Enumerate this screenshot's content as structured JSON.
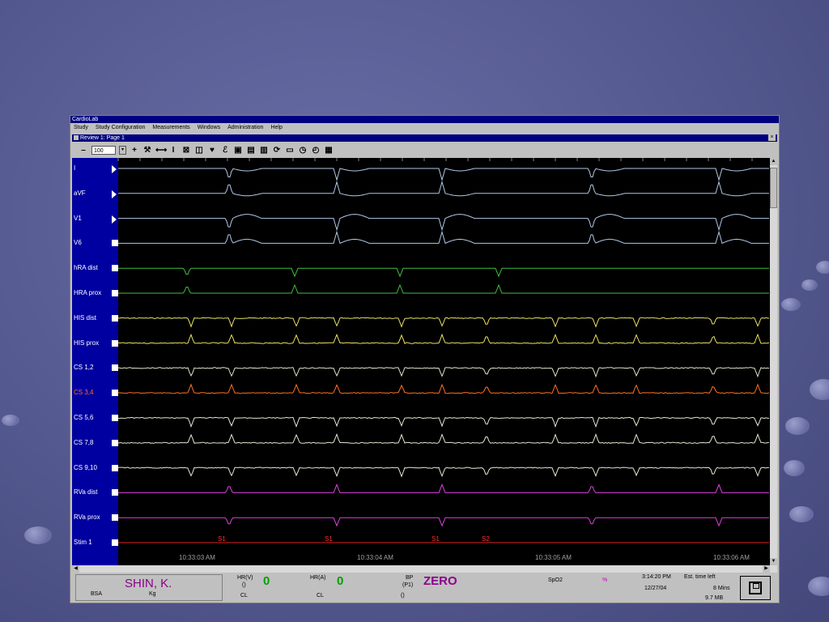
{
  "app": {
    "title": "CardioLab"
  },
  "menu": [
    "Study",
    "Study Configuration",
    "Measurements",
    "Windows",
    "Administration",
    "Help"
  ],
  "review_window": {
    "title": "Review 1: Page 1",
    "close": "×"
  },
  "toolbar": {
    "zoom_value": "100",
    "dropdown_glyph": "▾",
    "minus": "–",
    "plus": "+"
  },
  "channels": [
    {
      "label": "I",
      "color": "#b0c8e8",
      "label_color": "#ffffff",
      "btn": "tri"
    },
    {
      "label": "aVF",
      "color": "#b0c8e8",
      "label_color": "#ffffff",
      "btn": "tri"
    },
    {
      "label": "V1",
      "color": "#b0c8e8",
      "label_color": "#ffffff",
      "btn": "tri"
    },
    {
      "label": "V6",
      "color": "#b0c8e8",
      "label_color": "#ffffff",
      "btn": "box"
    },
    {
      "label": "hRA dist",
      "color": "#40c040",
      "label_color": "#ffffff",
      "btn": "box"
    },
    {
      "label": "HRA prox",
      "color": "#40c040",
      "label_color": "#ffffff",
      "btn": "box"
    },
    {
      "label": "HIS dist",
      "color": "#e8e060",
      "label_color": "#ffffff",
      "btn": "box"
    },
    {
      "label": "HIS prox",
      "color": "#e8e060",
      "label_color": "#ffffff",
      "btn": "box"
    },
    {
      "label": "CS 1,2",
      "color": "#e0e0c8",
      "label_color": "#ffffff",
      "btn": "box"
    },
    {
      "label": "CS 3,4",
      "color": "#ff7020",
      "label_color": "#ff7020",
      "btn": "box"
    },
    {
      "label": "CS 5,6",
      "color": "#e0e8d0",
      "label_color": "#ffffff",
      "btn": "box"
    },
    {
      "label": "CS 7,8",
      "color": "#e0e8d0",
      "label_color": "#ffffff",
      "btn": "box"
    },
    {
      "label": "CS 9,10",
      "color": "#e0e8d0",
      "label_color": "#ffffff",
      "btn": "box"
    },
    {
      "label": "RVa dist",
      "color": "#e040e0",
      "label_color": "#ffffff",
      "btn": "box"
    },
    {
      "label": "RVa prox",
      "color": "#e040e0",
      "label_color": "#ffffff",
      "btn": "box"
    },
    {
      "label": "Stim 1",
      "color": "#e02020",
      "label_color": "#ffffff",
      "btn": "box"
    }
  ],
  "stim_markers": [
    "S1",
    "S1",
    "S1",
    "S2"
  ],
  "time_labels": [
    "10:33:03 AM",
    "10:33:04 AM",
    "10:33:05 AM",
    "10:33:06 AM"
  ],
  "status": {
    "patient_name": "SHIN, K.",
    "bsa_label": "BSA",
    "kg_label": "Kg",
    "hrv_label": "HR(V)",
    "hrv_sub": "()",
    "hrv_value": "0",
    "hrv_cl": "CL",
    "hra_label": "HR(A)",
    "hra_value": "0",
    "hra_cl": "CL",
    "bp_label": "BP",
    "bp_sub": "(P1)",
    "bp_value": "ZERO",
    "bp_paren": "()",
    "spo2_label": "SpO2",
    "spo2_unit": "%",
    "time": "3:14:20 PM",
    "date": "12/27/04",
    "est_label": "Est. time left",
    "est_value": "8 Mins",
    "size": "9.7 MB"
  },
  "colors": {
    "label_bar": "#0000a0",
    "title_bar": "#000080",
    "ecg": "#b0c8e8"
  },
  "icons": [
    "minus-icon",
    "plus-icon",
    "tools-icon",
    "interval-icon",
    "caliper-icon",
    "cancel-icon",
    "compare-icon",
    "heart-icon",
    "script-icon",
    "folder-icon",
    "print-icon",
    "print-preview-icon",
    "refresh-icon",
    "monitor-icon",
    "clock-icon",
    "timer-icon",
    "grid-icon",
    "save-icon"
  ]
}
